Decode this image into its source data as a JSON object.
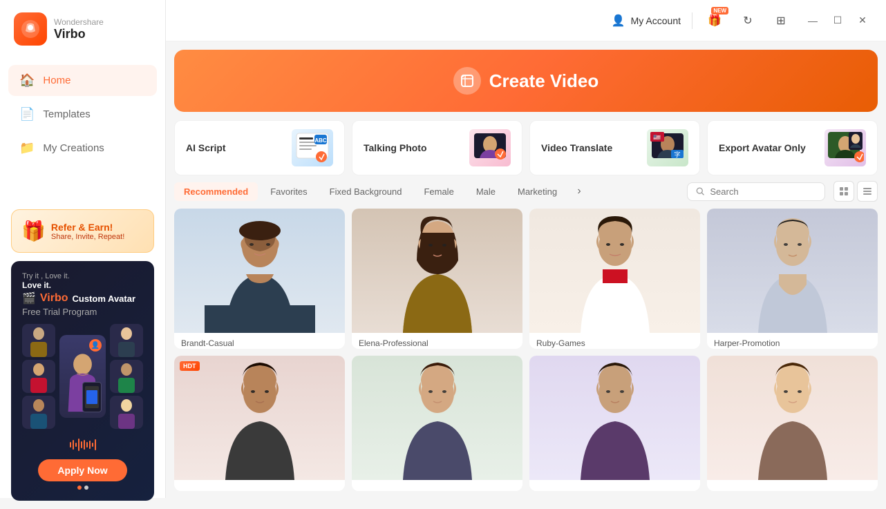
{
  "app": {
    "brand": "Wondershare",
    "product": "Virbo"
  },
  "header": {
    "my_account_label": "My Account",
    "new_badge": "NEW"
  },
  "sidebar": {
    "nav_items": [
      {
        "id": "home",
        "label": "Home",
        "icon": "🏠",
        "active": true
      },
      {
        "id": "templates",
        "label": "Templates",
        "icon": "📄",
        "active": false
      },
      {
        "id": "my-creations",
        "label": "My Creations",
        "icon": "📁",
        "active": false
      }
    ],
    "promo_refer": {
      "title": "Refer & Earn!",
      "subtitle": "Share, Invite, Repeat!"
    },
    "promo_avatar": {
      "try_label": "Try it , Love it.",
      "product_label": "Virbo Custom Avatar",
      "free_label": "Free Trial Program",
      "apply_label": "Apply Now"
    }
  },
  "hero": {
    "create_video_label": "Create Video"
  },
  "features": [
    {
      "id": "ai-script",
      "title": "AI Script"
    },
    {
      "id": "talking-photo",
      "title": "Talking Photo"
    },
    {
      "id": "video-translate",
      "title": "Video Translate"
    },
    {
      "id": "export-avatar",
      "title": "Export Avatar Only"
    }
  ],
  "tabs": [
    {
      "id": "recommended",
      "label": "Recommended",
      "active": true
    },
    {
      "id": "favorites",
      "label": "Favorites",
      "active": false
    },
    {
      "id": "fixed-bg",
      "label": "Fixed Background",
      "active": false
    },
    {
      "id": "female",
      "label": "Female",
      "active": false
    },
    {
      "id": "male",
      "label": "Male",
      "active": false
    },
    {
      "id": "marketing",
      "label": "Marketing",
      "active": false
    }
  ],
  "search": {
    "placeholder": "Search"
  },
  "avatars_row1": [
    {
      "id": "brandt",
      "name": "Brandt-Casual",
      "bg": "person-bg-1",
      "hdt": false
    },
    {
      "id": "elena",
      "name": "Elena-Professional",
      "bg": "person-bg-2",
      "hdt": false
    },
    {
      "id": "ruby",
      "name": "Ruby-Games",
      "bg": "person-bg-3",
      "hdt": false
    },
    {
      "id": "harper",
      "name": "Harper-Promotion",
      "bg": "person-bg-4",
      "hdt": false
    }
  ],
  "avatars_row2": [
    {
      "id": "avatar5",
      "name": "",
      "bg": "person-bg-5",
      "hdt": true
    },
    {
      "id": "avatar6",
      "name": "",
      "bg": "person-bg-6",
      "hdt": false
    },
    {
      "id": "avatar7",
      "name": "",
      "bg": "person-bg-7",
      "hdt": false
    },
    {
      "id": "avatar8",
      "name": "",
      "bg": "person-bg-8",
      "hdt": false
    }
  ],
  "colors": {
    "accent": "#ff6b35",
    "bg": "#f5f5f5",
    "sidebar_bg": "#ffffff"
  }
}
